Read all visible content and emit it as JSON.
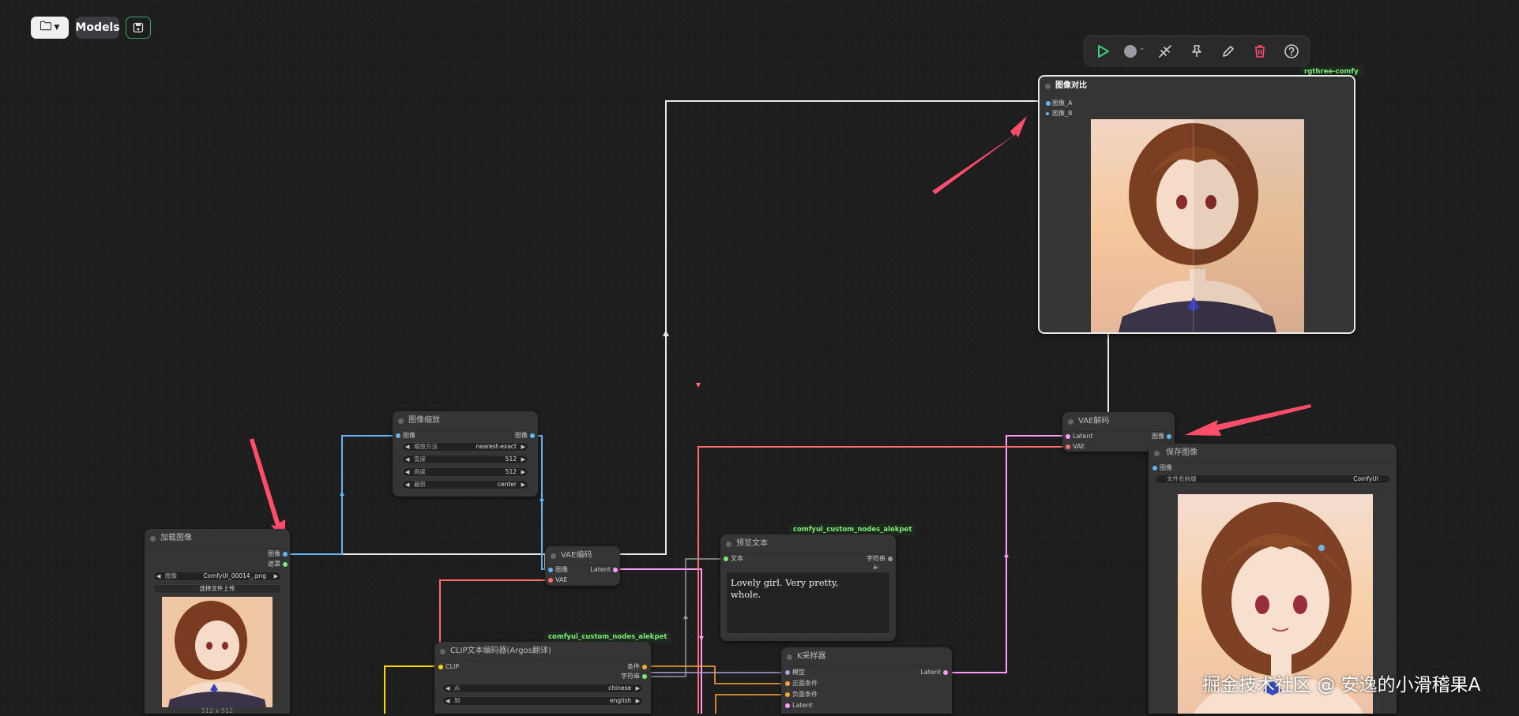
{
  "top_bar": {
    "models_label": "Models"
  },
  "toolbar": {
    "icons": [
      "play-icon",
      "color-circle-icon",
      "bypass-icon",
      "pin-icon",
      "edit-icon",
      "trash-icon",
      "help-icon"
    ]
  },
  "nodes": {
    "image_compare": {
      "title": "图像对比",
      "tag": "rgthree-comfy",
      "inputs": [
        "图像_A",
        "图像_B"
      ]
    },
    "vae_decode": {
      "title": "VAE解码",
      "inputs": [
        "Latent",
        "VAE"
      ],
      "output": "图像"
    },
    "save_image": {
      "title": "保存图像",
      "input": "图像",
      "widget_label": "文件名前缀",
      "widget_value": "ComfyUI"
    },
    "image_scale": {
      "title": "图像缩放",
      "input": "图像",
      "output": "图像",
      "widgets": [
        {
          "label": "缩放方法",
          "value": "nearest-exact"
        },
        {
          "label": "宽度",
          "value": "512"
        },
        {
          "label": "高度",
          "value": "512"
        },
        {
          "label": "裁剪",
          "value": "center"
        }
      ]
    },
    "load_image": {
      "title": "加载图像",
      "outputs": [
        "图像",
        "遮罩"
      ],
      "widget_label": "图像",
      "widget_value": "ComfyUI_00014_.png",
      "upload_label": "选择文件上传",
      "size_label": "512 x 512"
    },
    "vae_encode": {
      "title": "VAE编码",
      "inputs": [
        "图像",
        "VAE"
      ],
      "output": "Latent"
    },
    "preview_text": {
      "title": "预览文本",
      "tag": "comfyui_custom_nodes_alekpet",
      "input": "文本",
      "output": "字符串",
      "text": "Lovely girl. Very pretty,\nwhole."
    },
    "clip_encoder": {
      "title": "CLIP文本编码器(Argos翻译)",
      "tag": "comfyui_custom_nodes_alekpet",
      "input": "CLIP",
      "outputs": [
        "条件",
        "字符串"
      ],
      "widgets": [
        {
          "label": "从",
          "value": "chinese"
        },
        {
          "label": "到",
          "value": "english"
        }
      ]
    },
    "ksampler": {
      "title": "K采样器",
      "inputs": [
        "模型",
        "正面条件",
        "负面条件",
        "Latent"
      ],
      "output": "Latent"
    }
  },
  "watermark": "掘金技术社区 @ 安逸的小滑稽果A",
  "colors": {
    "canvas": "#1e1e1f",
    "node_body": "#353535",
    "image_wire": "#64b5f6",
    "latent_wire": "#ff9cf9",
    "vae_wire": "#ff6e6e",
    "clip_wire": "#ffd500",
    "arrow": "#ff4d6a"
  }
}
